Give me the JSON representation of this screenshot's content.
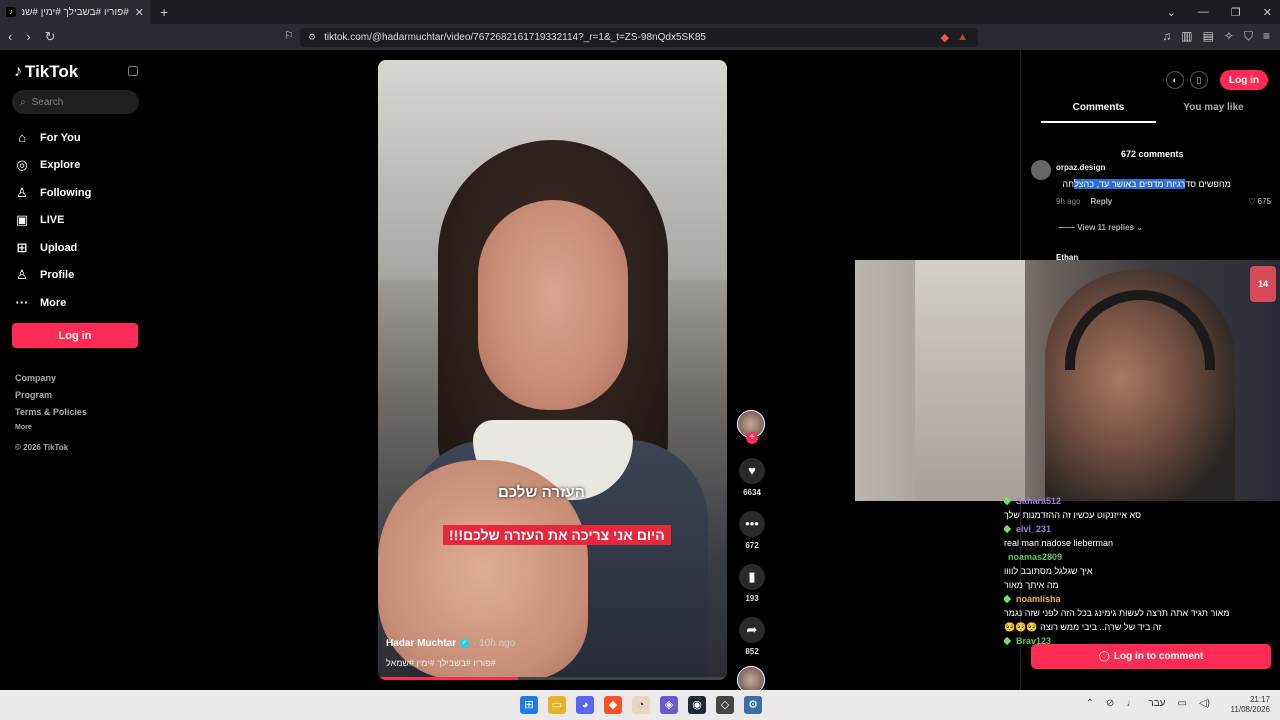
{
  "browser": {
    "tab_title": "#פוריו #בשבילך #ימין #שמאל| 🙂 |#",
    "tab_close": "✕",
    "new_tab": "+",
    "url": "tiktok.com/@hadarmuchtar/video/7672682161719332114?_r=1&_t=ZS-98nQdx5SK85",
    "window_controls": [
      "⌄",
      "—",
      "❐",
      "✕"
    ]
  },
  "sidebar": {
    "logo": "TikTok",
    "search_placeholder": "Search",
    "items": [
      {
        "label": "For You",
        "icon": "⌂"
      },
      {
        "label": "Explore",
        "icon": "◎"
      },
      {
        "label": "Following",
        "icon": "♙"
      },
      {
        "label": "LIVE",
        "icon": "▣"
      },
      {
        "label": "Upload",
        "icon": "⊞"
      },
      {
        "label": "Profile",
        "icon": "♙"
      },
      {
        "label": "More",
        "icon": "···"
      }
    ],
    "login": "Log in",
    "footer": [
      "Company",
      "Program",
      "Terms & Policies"
    ],
    "footer_more": "More",
    "copyright": "© 2026 TikTok"
  },
  "video": {
    "caption_top": "העזרה שלכם",
    "caption_main": "היום אני צריכה את העזרה שלכם!!!",
    "author": "Hadar Muchtar",
    "ago": "· 10h ago",
    "hashtags": "#פוריו #בשבילך #ימין #שמאל",
    "progress": 0.4
  },
  "actions": {
    "likes": "6634",
    "comments": "672",
    "saves": "193",
    "shares": "852"
  },
  "rpanel": {
    "login": "Log in",
    "tabs": [
      "Comments",
      "You may like"
    ],
    "count": "672 comments",
    "comment": {
      "user": "orpaz.design",
      "text_pre": "מחפשים סד",
      "text_hl": "רגיות מדפים באושר עד, כהצל",
      "text_post": "חה",
      "ago": "9h ago",
      "reply": "Reply",
      "likes": "675"
    },
    "view_replies": "View 11 replies ⌄",
    "next_user": "Ethan",
    "login_comment": "Log in to comment"
  },
  "webcam": {
    "badge": "14"
  },
  "chat": [
    {
      "user": "Sahara512",
      "class": "purple",
      "msg": "סא אייזנקוט עכשיו זה ההזדמנות שלך"
    },
    {
      "user": "eivi_231",
      "class": "purple",
      "msg": "real man nadose lieberman"
    },
    {
      "user": "noamas2809",
      "class": "green2",
      "msg": "איך שגלגל מסתובב לוווו"
    },
    {
      "user": "",
      "class": "",
      "msg": "מה איתך מאור"
    },
    {
      "user": "noamlisha",
      "class": "orange",
      "msg": "מאור תגיד אתה תרצה לעשות גימינג בכל הזה לפני שזה נגמר"
    },
    {
      "user": "",
      "class": "",
      "msg": "זה ביד של שרה.. ביבי ממש רוצה 🥺🥺🥺"
    },
    {
      "user": "Brav123",
      "class": "green2",
      "msg": ""
    }
  ],
  "taskbar": {
    "time": "21:17",
    "date": "11/08/2026",
    "lang": "עבר"
  },
  "colors": {
    "accent": "#fe2c55",
    "highlight": "#2e6cd6"
  }
}
